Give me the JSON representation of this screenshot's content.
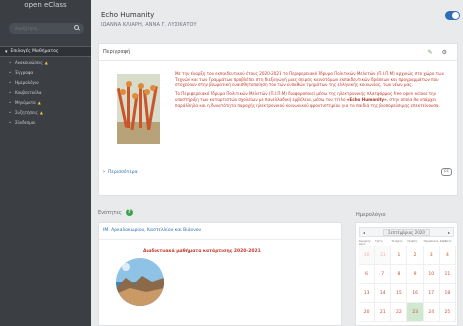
{
  "sidebar": {
    "brand": "open eClass",
    "search_placeholder": "Αναζήτηση...",
    "section_title": "Επιλογές Μαθήματος",
    "items": [
      {
        "label": "Ανακοινώσεις",
        "icon": "bullhorn-icon",
        "warn": true
      },
      {
        "label": "Έγγραφα",
        "icon": "folder-icon",
        "warn": false
      },
      {
        "label": "Ημερολόγιο",
        "icon": "calendar-icon",
        "warn": false
      },
      {
        "label": "Κουβεντούλα",
        "icon": "chat-icon",
        "warn": false
      },
      {
        "label": "Μηνύματα",
        "icon": "envelope-icon",
        "warn": true
      },
      {
        "label": "Συζητήσεις",
        "icon": "comments-icon",
        "warn": true
      },
      {
        "label": "Σύνδεσμοι",
        "icon": "link-icon",
        "warn": false
      }
    ]
  },
  "course": {
    "title": "Echo Humanity",
    "instructors": "ΙΩΑΝΝΑ ΚΛΙΑΡΗ, ΑΝΝΑ Γ. ΛΥΣΙΚΑΤΟΥ"
  },
  "description": {
    "header": "Περιγραφή",
    "p1": "Με την έναρξη του εκπαιδευτικού έτους 2020-2021 το Περιφερειακό Ίδρυμα Πολιτικών Μελετών (Π.Ι.Π.Μ) αρχικώς στο χώρο των Τεχνών και των Γραμμάτων προβλέπει στη διεξαγωγή μιας σειράς καινοτόμων εκπαιδευτικών δράσεων και προγραμμάτων που στοχεύουν στην βιωματική ευαισθητοποίηση του των ευπαθών τμημάτων της ελληνικής κοινωνίας, των νέων μας.",
    "p2_a": "Το Περιφερειακό Ίδρυμα Πολιτικών Μελετών (Π.Ι.Π.Μ) διαφοροποιεί μέσω της ηλεκτρονικής πλατφόρμας free open eclass την υποστήριξη των καταρτιστών σχολείων με πανελλαδική εμβέλεια, μέσω του τίτλο",
    "p2_bold": "«Echo Humanity»",
    "p2_b": ", στην οποία θα υπάρχει παράλληλα και η δυνατότητα παροχής ηλεκτρονικού κοινωνικού φροντιστηρίου για τα παιδιά της βιοπορεύσιμης επεκτείνουσα.",
    "more_label": "Περισσότερα",
    "license": "cc"
  },
  "units": {
    "label": "Ενότητες",
    "title": "ΙΜ. Αρκαλοκωρίου, Καστελλίου και Βιάννου",
    "subtitle": "Διαδικτυακά μαθήματα κατάρτισης 2020-2021"
  },
  "calendar": {
    "label": "Ημερολόγιο",
    "month": "Σεπτέμβριος 2020",
    "prev": "◂",
    "next": "▸",
    "weekdays": [
      "Κυριακή/Δευτ.",
      "Τρίτη",
      "Τετάρτη",
      "Πέμπτη",
      "Παρασκευή",
      "Σάββατο"
    ],
    "weeks": [
      [
        "30",
        "31",
        "1",
        "2",
        "3",
        "4"
      ],
      [
        "6",
        "7",
        "8",
        "9",
        "10",
        "11"
      ],
      [
        "13",
        "14",
        "15",
        "16",
        "17",
        "18"
      ],
      [
        "20",
        "21",
        "22",
        "23",
        "24",
        "25"
      ]
    ],
    "today": "23"
  },
  "colors": {
    "sidebar_bg": "#3b3f44",
    "link": "#2b6cb0",
    "text_red": "#c0392b",
    "toggle": "#2f6db5",
    "help_green": "#3fa34d"
  }
}
